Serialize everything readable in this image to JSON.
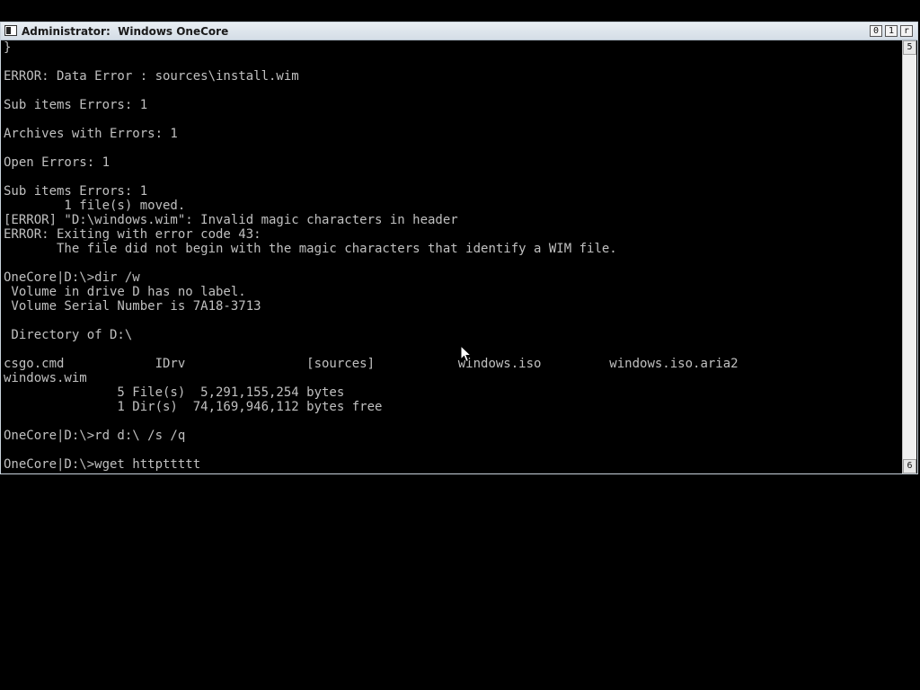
{
  "window": {
    "title": "Administrator:  Windows OneCore",
    "controls": {
      "minimize": "0",
      "maximize": "1",
      "close": "r"
    }
  },
  "scrollbar": {
    "up_glyph": "5",
    "down_glyph": "6"
  },
  "console": {
    "lines": [
      "}",
      "",
      "ERROR: Data Error : sources\\install.wim",
      "",
      "Sub items Errors: 1",
      "",
      "Archives with Errors: 1",
      "",
      "Open Errors: 1",
      "",
      "Sub items Errors: 1",
      "        1 file(s) moved.",
      "[ERROR] \"D:\\windows.wim\": Invalid magic characters in header",
      "ERROR: Exiting with error code 43:",
      "       The file did not begin with the magic characters that identify a WIM file.",
      "",
      "OneCore|D:\\>dir /w",
      " Volume in drive D has no label.",
      " Volume Serial Number is 7A18-3713",
      "",
      " Directory of D:\\",
      "",
      "csgo.cmd            IDrv                [sources]           windows.iso         windows.iso.aria2",
      "windows.wim",
      "               5 File(s)  5,291,155,254 bytes",
      "               1 Dir(s)  74,169,946,112 bytes free",
      "",
      "OneCore|D:\\>rd d:\\ /s /q",
      "",
      "OneCore|D:\\>wget httpttttt"
    ]
  },
  "colors": {
    "console_bg": "#000000",
    "console_fg": "#c0c0c0",
    "titlebar": "#dfe6ed"
  },
  "icons": {
    "system_menu": "console-app-icon",
    "pointer": "mouse-pointer-icon"
  }
}
